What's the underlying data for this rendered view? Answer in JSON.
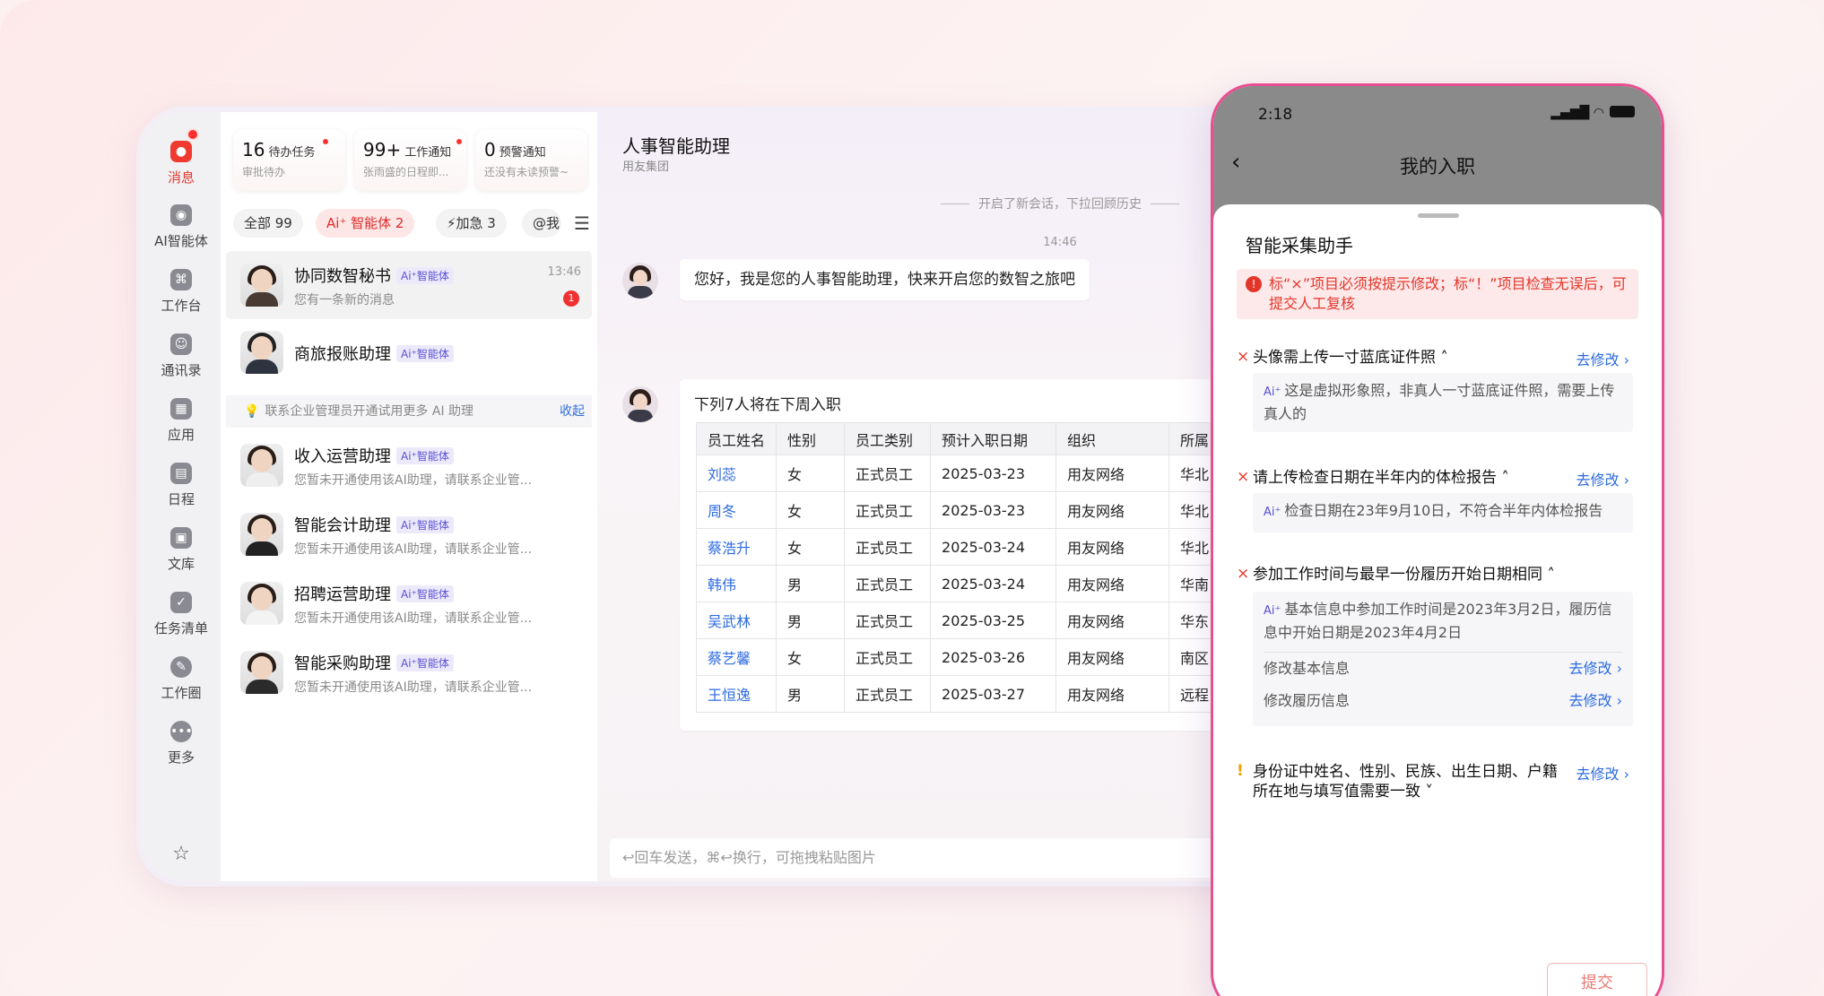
{
  "rail": {
    "items": [
      {
        "label": "消息",
        "icon": "chat-bubble-icon"
      },
      {
        "label": "AI智能体",
        "icon": "ai-agent-icon"
      },
      {
        "label": "工作台",
        "icon": "workbench-icon"
      },
      {
        "label": "通讯录",
        "icon": "contacts-icon"
      },
      {
        "label": "应用",
        "icon": "apps-icon"
      },
      {
        "label": "日程",
        "icon": "calendar-icon"
      },
      {
        "label": "文库",
        "icon": "library-icon"
      },
      {
        "label": "任务清单",
        "icon": "tasklist-icon"
      },
      {
        "label": "工作圈",
        "icon": "compass-icon"
      },
      {
        "label": "更多",
        "icon": "more-icon"
      }
    ],
    "star": "☆"
  },
  "cards": [
    {
      "num": "16",
      "label": "待办任务",
      "sub": "审批待办"
    },
    {
      "num": "99+",
      "label": "工作通知",
      "sub": "张雨盛的日程即..."
    },
    {
      "num": "0",
      "label": "预警通知",
      "sub": "还没有未读预警~"
    }
  ],
  "chips": {
    "all": "全部 99",
    "ai": "Ai⁺ 智能体 2",
    "urgent": "⚡加急 3",
    "at": "@我"
  },
  "ai_tag": "Ai⁺智能体",
  "conversations": [
    {
      "name": "协同数智秘书",
      "preview": "您有一条新的消息",
      "time": "13:46",
      "unread": "1"
    },
    {
      "name": "商旅报账助理",
      "preview": "",
      "time": "",
      "unread": ""
    }
  ],
  "notice": {
    "text": "联系企业管理员开通试用更多 AI 助理",
    "action": "收起"
  },
  "assistants": [
    {
      "name": "收入运营助理",
      "preview": "您暂未开通使用该AI助理，请联系企业管..."
    },
    {
      "name": "智能会计助理",
      "preview": "您暂未开通使用该AI助理，请联系企业管..."
    },
    {
      "name": "招聘运营助理",
      "preview": "您暂未开通使用该AI助理，请联系企业管..."
    },
    {
      "name": "智能采购助理",
      "preview": "您暂未开通使用该AI助理，请联系企业管..."
    }
  ],
  "chat": {
    "title": "人事智能助理",
    "org": "用友集团",
    "system_msg": "开启了新会话，下拉回顾历史",
    "timestamp": "14:46",
    "greeting": "您好，我是您的人事智能助理，快来开启您的数智之旅吧",
    "table_intro": "下列7人将在下周入职",
    "table_headers": [
      "员工姓名",
      "性别",
      "员工类别",
      "预计入职日期",
      "组织",
      "所属"
    ],
    "table_rows": [
      [
        "刘蕊",
        "女",
        "正式员工",
        "2025-03-23",
        "用友网络",
        "华北"
      ],
      [
        "周冬",
        "女",
        "正式员工",
        "2025-03-23",
        "用友网络",
        "华北"
      ],
      [
        "蔡浩升",
        "女",
        "正式员工",
        "2025-03-24",
        "用友网络",
        "华北"
      ],
      [
        "韩伟",
        "男",
        "正式员工",
        "2025-03-24",
        "用友网络",
        "华南"
      ],
      [
        "吴武林",
        "男",
        "正式员工",
        "2025-03-25",
        "用友网络",
        "华东"
      ],
      [
        "蔡艺馨",
        "女",
        "正式员工",
        "2025-03-26",
        "用友网络",
        "南区"
      ],
      [
        "王恒逸",
        "男",
        "正式员工",
        "2025-03-27",
        "用友网络",
        "远程"
      ]
    ],
    "input_placeholder": "↩回车发送，⌘↩换行，可拖拽粘贴图片"
  },
  "phone": {
    "time": "2:18",
    "title": "我的入职",
    "sheet_title": "智能采集助手",
    "alert": "标“×”项目必须按提示修改；标“！”项目检查无误后，可提交人工复核",
    "fix_label": "去修改 ›",
    "items": [
      {
        "mark": "×",
        "text": "头像需上传一寸蓝底证件照 ˄",
        "detail": "这是虚拟形象照，非真人一寸蓝底证件照，需要上传真人的"
      },
      {
        "mark": "×",
        "text": "请上传检查日期在半年内的体检报告 ˄",
        "detail": "检查日期在23年9月10日，不符合半年内体检报告"
      },
      {
        "mark": "×",
        "text": "参加工作时间与最早一份履历开始日期相同 ˄",
        "detail": "基本信息中参加工作时间是2023年3月2日，履历信息中开始日期是2023年4月2日"
      },
      {
        "mark": "!",
        "text": "身份证中姓名、性别、民族、出生日期、户籍所在地与填写值需要一致 ˅",
        "detail": ""
      }
    ],
    "sub_fixes": [
      "修改基本信息",
      "修改履历信息"
    ],
    "ai_mark": "Ai⁺",
    "submit": "提交"
  }
}
